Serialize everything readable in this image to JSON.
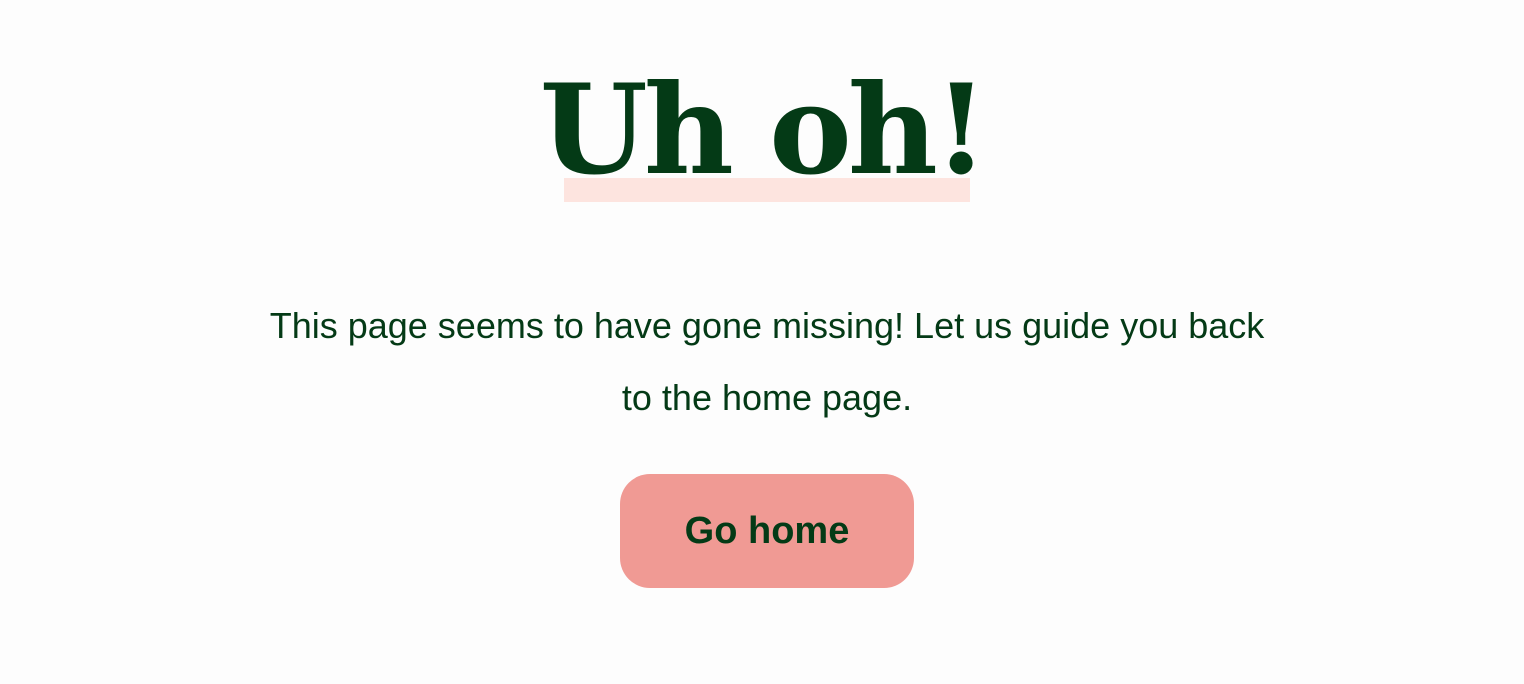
{
  "headline": "Uh oh!",
  "message": "This page seems to have gone missing! Let us guide you back to the home page.",
  "button": {
    "label": "Go home"
  },
  "colors": {
    "background": "#fdfdfd",
    "text": "#043a16",
    "highlight": "#fde4df",
    "button": "#f09a94"
  }
}
